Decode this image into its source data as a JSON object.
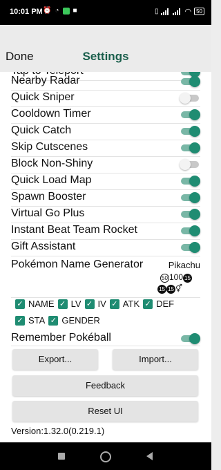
{
  "status_bar": {
    "time": "10:01 PM",
    "battery": "50"
  },
  "header": {
    "done_label": "Done",
    "title": "Settings"
  },
  "partial_row_label": "Tap to Teleport",
  "settings_rows": [
    {
      "label": "Nearby Radar",
      "enabled": true
    },
    {
      "label": "Quick Sniper",
      "enabled": false
    },
    {
      "label": "Cooldown Timer",
      "enabled": true
    },
    {
      "label": "Quick Catch",
      "enabled": true
    },
    {
      "label": "Skip Cutscenes",
      "enabled": true
    },
    {
      "label": "Block Non-Shiny",
      "enabled": false
    },
    {
      "label": "Quick Load Map",
      "enabled": true
    },
    {
      "label": "Spawn Booster",
      "enabled": true
    },
    {
      "label": "Virtual Go Plus",
      "enabled": true
    },
    {
      "label": "Instant Beat Team Rocket",
      "enabled": true
    },
    {
      "label": "Gift Assistant",
      "enabled": true
    }
  ],
  "name_generator": {
    "label": "Pokémon Name Generator",
    "preview_name": "Pikachu",
    "preview_badge_1": "50",
    "preview_number": "100",
    "preview_badge_2": "15",
    "preview_badge_3": "15",
    "preview_badge_4": "15",
    "preview_gender": "⚥"
  },
  "name_options": [
    {
      "label": "NAME",
      "checked": true
    },
    {
      "label": "LV",
      "checked": true
    },
    {
      "label": "IV",
      "checked": true
    },
    {
      "label": "ATK",
      "checked": true
    },
    {
      "label": "DEF",
      "checked": true
    },
    {
      "label": "STA",
      "checked": true
    },
    {
      "label": "GENDER",
      "checked": true
    }
  ],
  "remember_pokeball": {
    "label": "Remember Pokéball",
    "enabled": true
  },
  "buttons": {
    "export": "Export...",
    "import": "Import...",
    "feedback": "Feedback",
    "reset": "Reset UI"
  },
  "version": "Version:1.32.0(0.219.1)",
  "colors": {
    "accent": "#1f8c72",
    "title": "#195e4b"
  }
}
